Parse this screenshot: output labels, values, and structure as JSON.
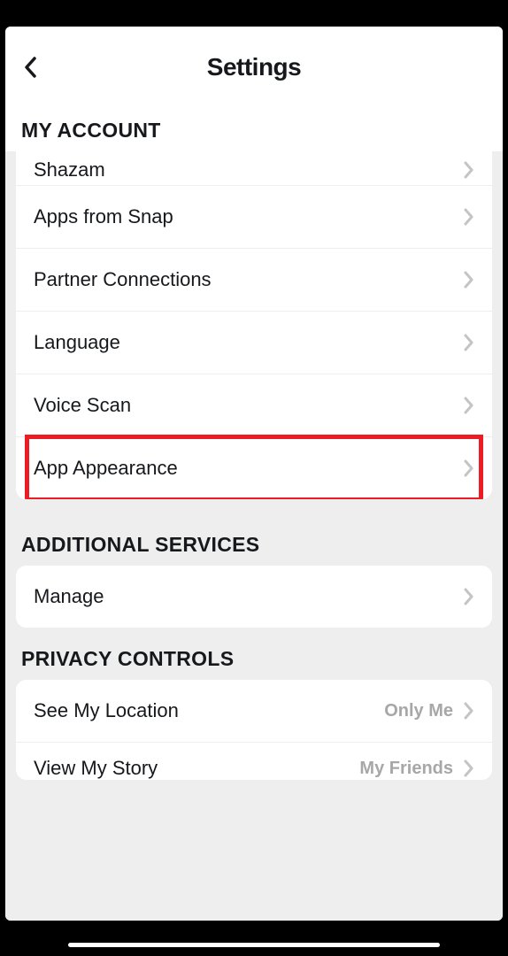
{
  "header": {
    "title": "Settings"
  },
  "sections": {
    "my_account": {
      "title": "MY ACCOUNT",
      "items": [
        {
          "label": "Shazam"
        },
        {
          "label": "Apps from Snap"
        },
        {
          "label": "Partner Connections"
        },
        {
          "label": "Language"
        },
        {
          "label": "Voice Scan"
        },
        {
          "label": "App Appearance",
          "highlighted": true
        }
      ]
    },
    "additional_services": {
      "title": "ADDITIONAL SERVICES",
      "items": [
        {
          "label": "Manage"
        }
      ]
    },
    "privacy_controls": {
      "title": "PRIVACY CONTROLS",
      "items": [
        {
          "label": "See My Location",
          "value": "Only Me"
        },
        {
          "label": "View My Story",
          "value": "My Friends",
          "partial": true
        }
      ]
    }
  }
}
